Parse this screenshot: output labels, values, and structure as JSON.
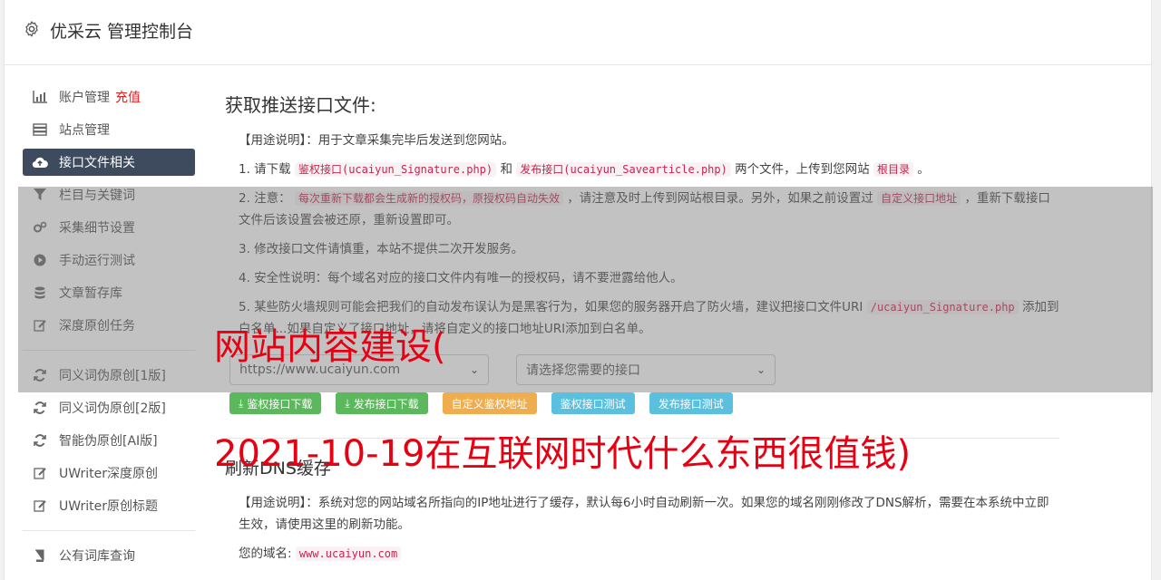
{
  "header": {
    "title": "优采云 管理控制台",
    "icon": "gear-icon"
  },
  "sidebar": {
    "items": [
      {
        "label": "账户管理",
        "extra": "充值",
        "icon": "bar-chart-icon"
      },
      {
        "label": "站点管理",
        "icon": "server-icon"
      },
      {
        "label": "接口文件相关",
        "icon": "cloud-upload-icon",
        "active": true
      },
      {
        "label": "栏目与关键词",
        "icon": "filter-icon"
      },
      {
        "label": "采集细节设置",
        "icon": "cogs-icon"
      },
      {
        "label": "手动运行测试",
        "icon": "play-icon"
      },
      {
        "label": "文章暂存库",
        "icon": "database-icon"
      },
      {
        "label": "深度原创任务",
        "icon": "edit-icon"
      },
      {
        "label": "同义词伪原创[1版]",
        "icon": "refresh-icon"
      },
      {
        "label": "同义词伪原创[2版]",
        "icon": "refresh-icon"
      },
      {
        "label": "智能伪原创[AI版]",
        "icon": "refresh-icon"
      },
      {
        "label": "UWriter深度原创",
        "icon": "edit-icon"
      },
      {
        "label": "UWriter原创标题",
        "icon": "edit-icon"
      },
      {
        "label": "公有词库查询",
        "icon": "book-icon"
      }
    ]
  },
  "main": {
    "section1_title": "获取推送接口文件:",
    "usage": "【用途说明】：用于文章采集完毕后发送到您网站。",
    "item1": {
      "a": "1. 请下载",
      "code1": "鉴权接口(ucaiyun_Signature.php)",
      "b": "和",
      "code2": "发布接口(ucaiyun_Savearticle.php)",
      "c": "两个文件，上传到您网站",
      "code3": "根目录",
      "d": "。"
    },
    "item2": {
      "a": "2. 注意：",
      "code1": "每次重新下载都会生成新的授权码，原授权码自动失效",
      "b": "，请注意及时上传到网站根目录。另外，如果之前设置过",
      "code2": "自定义接口地址",
      "c": "，重新下载接口文件后该设置会被还原，重新设置即可。"
    },
    "item3": "3. 修改接口文件请慎重，本站不提供二次开发服务。",
    "item4": "4. 安全性说明：每个域名对应的接口文件内有唯一的授权码，请不要泄露给他人。",
    "item5": {
      "a": "5. 某些防火墙规则可能会把我们的自动发布误认为是黑客行为，如果您的服务器开启了防火墙，建议把接口文件URI",
      "code1": "/ucaiyun_Signature.php",
      "b": "添加到白名单...如果自定义了接口地址，请将自定义的接口地址URI添加到白名单。"
    },
    "select_site": "https://www.ucaiyun.com",
    "select_api": "请选择您需要的接口",
    "buttons": {
      "dl_auth": "鉴权接口下载",
      "dl_publish": "发布接口下载",
      "custom_auth": "自定义鉴权地址",
      "test_auth": "鉴权接口测试",
      "test_publish": "发布接口测试"
    },
    "section2_title": "刷新DNS缓存",
    "dns_usage": "【用途说明】：系统对您的网站域名所指向的IP地址进行了缓存，默认每6小时自动刷新一次。如果您的域名刚刚修改了DNS解析，需要在本系统中立即生效，请使用这里的刷新功能。",
    "domain_label": "您的域名:",
    "domain_value": "www.ucaiyun.com"
  },
  "watermark": {
    "line1": "网站内容建设(",
    "line2": "2021-10-19在互联网时代什么东西很值钱)"
  }
}
